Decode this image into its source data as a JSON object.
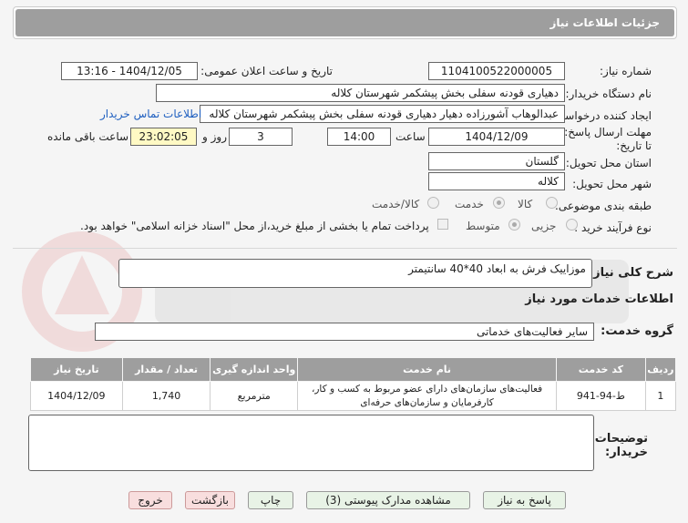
{
  "header": {
    "title": "جزئیات اطلاعات نیاز"
  },
  "form": {
    "need_number_label": "شماره نیاز:",
    "need_number": "1104100522000005",
    "announce_label": "تاریخ و ساعت اعلان عمومی:",
    "announce_value": "1404/12/05 - 13:16",
    "buyer_org_label": "نام دستگاه خریدار:",
    "buyer_org": "دهیاری قودنه سفلی بخش پیشکمر شهرستان کلاله",
    "creator_label": "ایجاد کننده درخواست:",
    "creator": "عبدالوهاب آشورزاده دهیار دهیاری قودنه سفلی بخش پیشکمر شهرستان کلاله",
    "contact_link": "اطلاعات تماس خریدار",
    "deadline_label": "مهلت ارسال پاسخ: تا تاریخ:",
    "deadline_date": "1404/12/09",
    "time_label": "ساعت",
    "deadline_time": "14:00",
    "days_value": "3",
    "days_label": "روز و",
    "remaining_time": "23:02:05",
    "remaining_label": "ساعت باقی مانده",
    "province_label": "استان محل تحویل:",
    "province": "گلستان",
    "city_label": "شهر محل تحویل:",
    "city": "کلاله",
    "category_label": "طبقه بندی موضوعی:",
    "category_options": [
      "کالا",
      "خدمت",
      "کالا/خدمت"
    ],
    "category_selected": "خدمت",
    "process_label": "نوع فرآیند خرید :",
    "process_options": [
      "جزیی",
      "متوسط"
    ],
    "process_selected": "متوسط",
    "payment_note": "پرداخت تمام یا بخشی از مبلغ خرید،از محل \"اسناد خزانه اسلامی\" خواهد بود."
  },
  "summary": {
    "label": "شرح کلی نیاز:",
    "value": "موزاییک فرش به ابعاد 40*40 سانتیمتر"
  },
  "services": {
    "section_title": "اطلاعات خدمات مورد نیاز",
    "group_label": "گروه خدمت:",
    "group_value": "سایر فعالیت‌های خدماتی",
    "columns": [
      "ردیف",
      "کد خدمت",
      "نام خدمت",
      "واحد اندازه گیری",
      "تعداد / مقدار",
      "تاریخ نیاز"
    ],
    "rows": [
      {
        "row": "1",
        "code": "ط-94-941",
        "name": "فعالیت‌های سازمان‌های دارای عضو مربوط به کسب و کار، کارفرمایان و سازمان‌های حرفه‌ای",
        "unit": "مترمربع",
        "qty": "1,740",
        "date": "1404/12/09"
      }
    ]
  },
  "notes": {
    "label_line1": "توضیحات",
    "label_line2": "خریدار:",
    "value": ""
  },
  "buttons": {
    "reply": "پاسخ به نیاز",
    "docs": "مشاهده مدارک پیوستی (3)",
    "print": "چاپ",
    "back": "بازگشت",
    "exit": "خروج"
  },
  "colors": {
    "header_bg": "#9e9e9e",
    "link": "#2060c0",
    "remaining_bg": "#fff9c4",
    "green_button": "#e8f3e6",
    "pink_button": "#f8dede"
  }
}
